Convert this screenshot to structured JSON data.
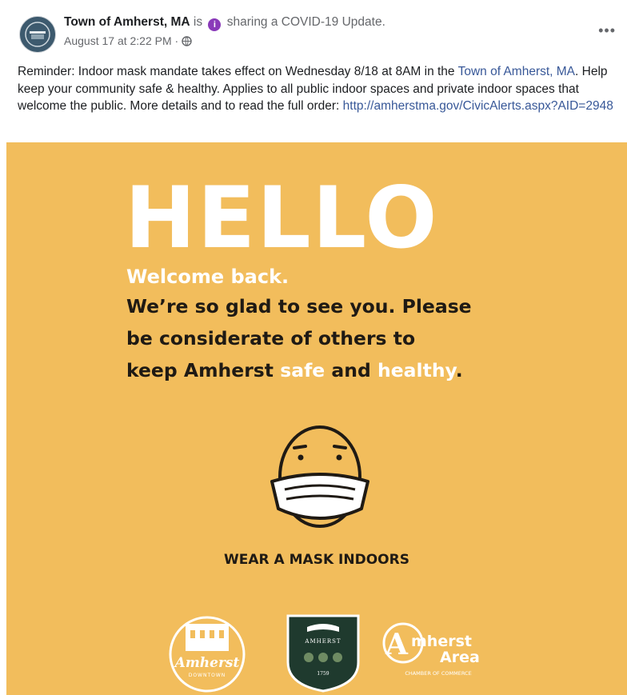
{
  "post": {
    "author": "Town of Amherst, MA",
    "is_text": "is",
    "info_glyph": "i",
    "activity": "sharing a COVID-19 Update.",
    "timestamp": "August 17 at 2:22 PM",
    "separator": "·",
    "more_glyph": "•••",
    "text_part1": "Reminder: Indoor mask mandate takes effect on Wednesday 8/18 at 8AM in the ",
    "text_link_town": "Town of Amherst, MA",
    "text_part2": ". Help keep your community safe & healthy. Applies to all public indoor spaces and private indoor spaces that welcome the public. More details and to read the full order: ",
    "text_link_url": "http://amherstma.gov/CivicAlerts.aspx?AID=2948"
  },
  "poster": {
    "hello": "HELLO",
    "welcome": "Welcome back.",
    "line1": "We’re so glad to see you. Please",
    "line2": "be considerate of others to",
    "line3_a": "keep Amherst ",
    "line3_safe": "safe",
    "line3_b": " and ",
    "line3_healthy": "healthy",
    "line3_c": ".",
    "wear": "WEAR A MASK INDOORS",
    "logo_downtown": "Amherst",
    "logo_downtown_sub": "DOWNTOWN",
    "logo_town": "AMHERST",
    "logo_town_year": "1759",
    "logo_chamber_1": "mherst",
    "logo_chamber_2": "Area",
    "logo_chamber_sub": "CHAMBER OF COMMERCE"
  },
  "colors": {
    "poster_bg": "#f2bd5c",
    "link": "#385898",
    "info_badge": "#8a3ab9"
  }
}
